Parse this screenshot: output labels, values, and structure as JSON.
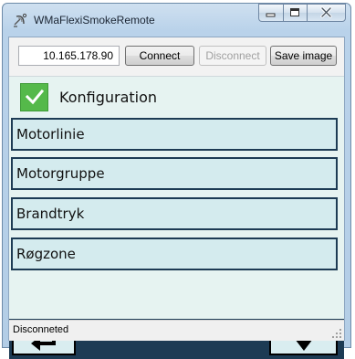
{
  "window": {
    "title": "WMaFlexiSmokeRemote",
    "icon": "satellite-dish-icon",
    "controls": [
      "minimize-icon",
      "maximize-icon",
      "close-icon"
    ]
  },
  "toolbar": {
    "ip_value": "10.165.178.90",
    "connect_label": "Connect",
    "disconnect_label": "Disconnect",
    "save_image_label": "Save image"
  },
  "config": {
    "checked": true,
    "label": "Konfiguration"
  },
  "menu": {
    "items": [
      {
        "label": "Motorlinie"
      },
      {
        "label": "Motorgruppe"
      },
      {
        "label": "Brandtryk"
      },
      {
        "label": "Røgzone"
      }
    ]
  },
  "nav": {
    "back_icon": "return-arrow-icon",
    "down_icon": "down-arrow-icon"
  },
  "status": {
    "text": "Disconneted"
  },
  "colors": {
    "panel_bg": "#e6f3f1",
    "item_bg": "#d4ebee",
    "dark_bar": "#1d3b54",
    "checkbox_green": "#55b94a"
  }
}
